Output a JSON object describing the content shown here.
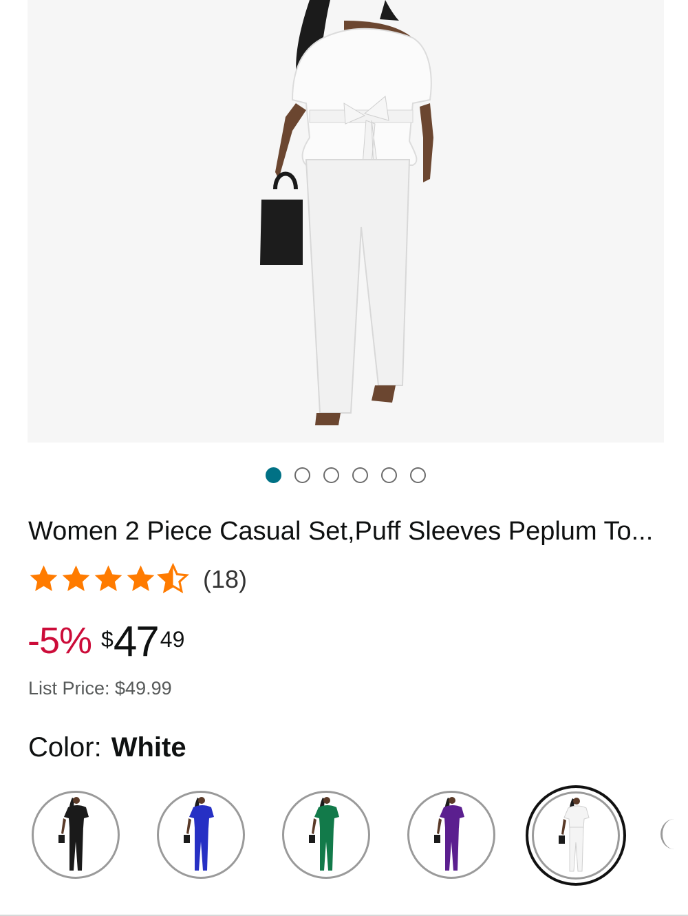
{
  "gallery": {
    "image_alt": "product-image",
    "total_images": 6,
    "active_index": 0
  },
  "product": {
    "title": "Women 2 Piece Casual Set,Puff Sleeves Peplum To...",
    "rating": 4.5,
    "rating_count": "(18)",
    "discount": "-5%",
    "price_symbol": "$",
    "price_whole": "47",
    "price_fraction": "49",
    "list_price": "List Price: $49.99"
  },
  "color": {
    "label": "Color:",
    "selected": "White",
    "options": [
      {
        "name": "Black",
        "hex": "#1a1a1a"
      },
      {
        "name": "Blue",
        "hex": "#2630c4"
      },
      {
        "name": "Green",
        "hex": "#127a4a"
      },
      {
        "name": "Purple",
        "hex": "#5b1f8f"
      },
      {
        "name": "White",
        "hex": "#f4f4f4"
      }
    ]
  },
  "colors": {
    "accent": "#007185",
    "star": "#ff7b00",
    "discount": "#cc0c39"
  }
}
